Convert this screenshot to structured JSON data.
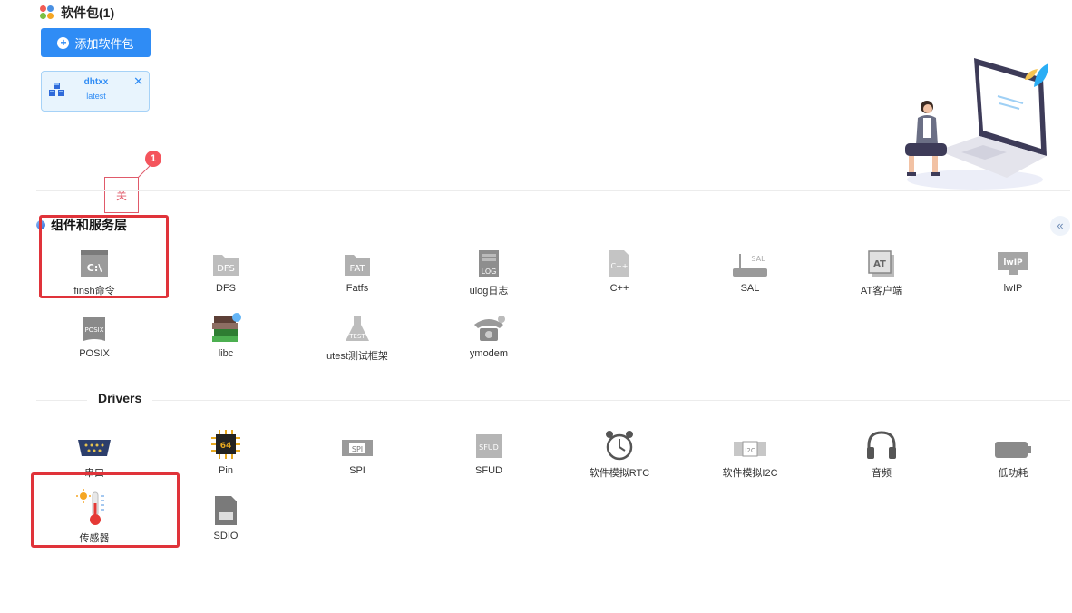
{
  "packages": {
    "title": "软件包(1)",
    "add_button": "添加软件包",
    "installed": [
      {
        "name": "dhtxx",
        "version": "latest"
      }
    ]
  },
  "annotation": {
    "badge": "1",
    "text": "关"
  },
  "component_section": {
    "title": "组件和服务层",
    "items": [
      {
        "label": "finsh命令",
        "icon": "terminal-icon"
      },
      {
        "label": "DFS",
        "icon": "folder-dfs-icon"
      },
      {
        "label": "Fatfs",
        "icon": "fat-icon"
      },
      {
        "label": "ulog日志",
        "icon": "log-icon"
      },
      {
        "label": "C++",
        "icon": "cpp-icon"
      },
      {
        "label": "SAL",
        "icon": "router-icon"
      },
      {
        "label": "AT客户端",
        "icon": "at-icon"
      },
      {
        "label": "lwIP",
        "icon": "lwip-icon"
      },
      {
        "label": "POSIX",
        "icon": "posix-icon"
      },
      {
        "label": "libc",
        "icon": "books-icon"
      },
      {
        "label": "utest测试框架",
        "icon": "flask-icon"
      },
      {
        "label": "ymodem",
        "icon": "telephone-icon"
      }
    ]
  },
  "drivers_section": {
    "title": "Drivers",
    "items": [
      {
        "label": "串口",
        "icon": "serial-port-icon"
      },
      {
        "label": "Pin",
        "icon": "chip-icon"
      },
      {
        "label": "SPI",
        "icon": "spi-icon"
      },
      {
        "label": "SFUD",
        "icon": "sfud-icon"
      },
      {
        "label": "软件模拟RTC",
        "icon": "alarm-clock-icon"
      },
      {
        "label": "软件模拟I2C",
        "icon": "i2c-icon"
      },
      {
        "label": "音频",
        "icon": "headphones-icon"
      },
      {
        "label": "低功耗",
        "icon": "battery-icon"
      },
      {
        "label": "传感器",
        "icon": "thermometer-icon"
      },
      {
        "label": "SDIO",
        "icon": "sd-card-icon"
      }
    ]
  },
  "colors": {
    "accent": "#2f8cf5",
    "highlight_frame": "#e0333a",
    "annotation": "#f4545c"
  }
}
